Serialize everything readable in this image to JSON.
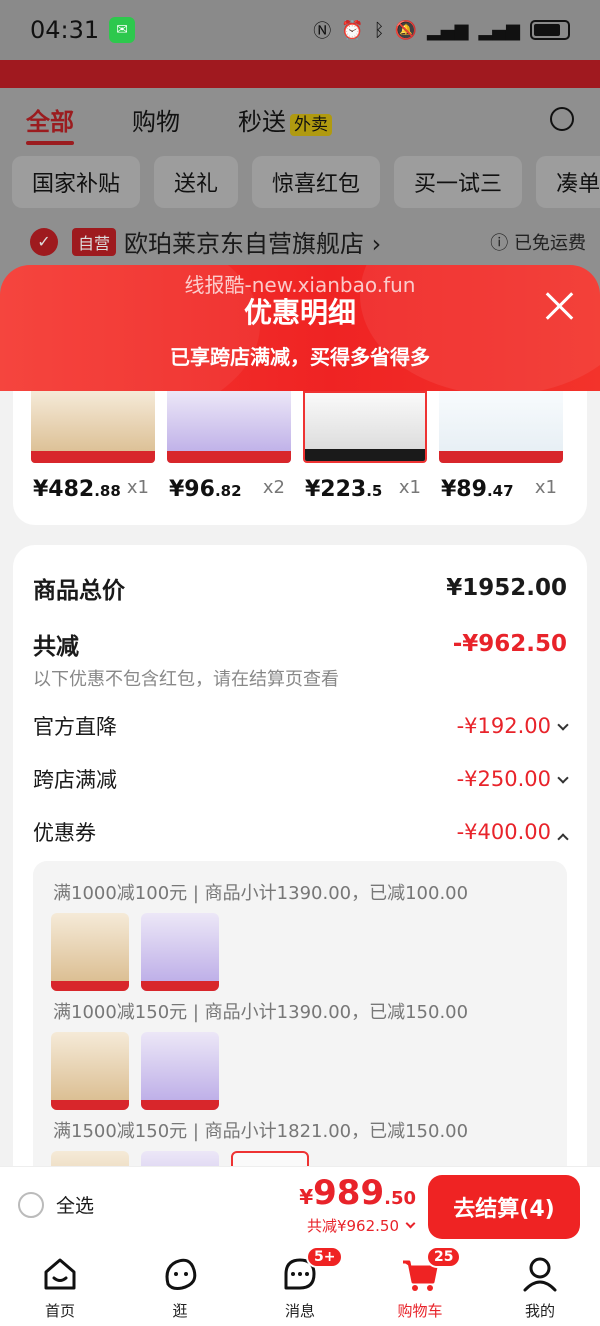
{
  "status_bar": {
    "time": "04:31",
    "app_badge": "wechat-icon"
  },
  "background_page": {
    "tabs": [
      "全部",
      "购物",
      "秒送"
    ],
    "takeout_badge": "外卖",
    "chips": [
      "国家补贴",
      "送礼",
      "惊喜红包",
      "买一试三",
      "凑单"
    ],
    "store_tag": "自营",
    "store_name": "欧珀莱京东自营旗舰店 ›",
    "shipping": "ⓘ 已免运费"
  },
  "sheet": {
    "watermark": "线报酷-new.xianbao.fun",
    "title": "优惠明细",
    "subtitle": "已享跨店满减，买得多省得多"
  },
  "products": [
    {
      "price_main": "¥482",
      "price_cents": ".88",
      "qty": "x1",
      "thumb": "gold"
    },
    {
      "price_main": "¥96",
      "price_cents": ".82",
      "qty": "x2",
      "thumb": "purple"
    },
    {
      "price_main": "¥223",
      "price_cents": ".5",
      "qty": "x1",
      "thumb": "shoe"
    },
    {
      "price_main": "¥89",
      "price_cents": ".47",
      "qty": "x1",
      "thumb": "white"
    }
  ],
  "summary": {
    "total_label": "商品总价",
    "total_value": "¥1952.00",
    "reduce_label": "共减",
    "reduce_value": "-¥962.50",
    "reduce_note": "以下优惠不包含红包，请在结算页查看",
    "items": [
      {
        "label": "官方直降",
        "value": "-¥192.00",
        "expanded": false
      },
      {
        "label": "跨店满减",
        "value": "-¥250.00",
        "expanded": false
      },
      {
        "label": "优惠券",
        "value": "-¥400.00",
        "expanded": true
      }
    ],
    "coupons": [
      "满1000减100元 | 商品小计1390.00，已减100.00",
      "满1000减150元 | 商品小计1390.00，已减150.00",
      "满1500减150元 | 商品小计1821.00，已减150.00"
    ]
  },
  "checkout": {
    "select_all": "全选",
    "currency": "¥",
    "price_main": "989",
    "price_cents": ".50",
    "reduce_text": "共减¥962.50",
    "button": "去结算(4)"
  },
  "bottom_nav": [
    {
      "label": "首页",
      "icon": "home-icon",
      "badge": ""
    },
    {
      "label": "逛",
      "icon": "browse-icon",
      "badge": ""
    },
    {
      "label": "消息",
      "icon": "message-icon",
      "badge": "5+"
    },
    {
      "label": "购物车",
      "icon": "cart-icon",
      "badge": "25"
    },
    {
      "label": "我的",
      "icon": "profile-icon",
      "badge": ""
    }
  ],
  "colors": {
    "accent": "#ef2323",
    "price_red": "#e8232a"
  }
}
